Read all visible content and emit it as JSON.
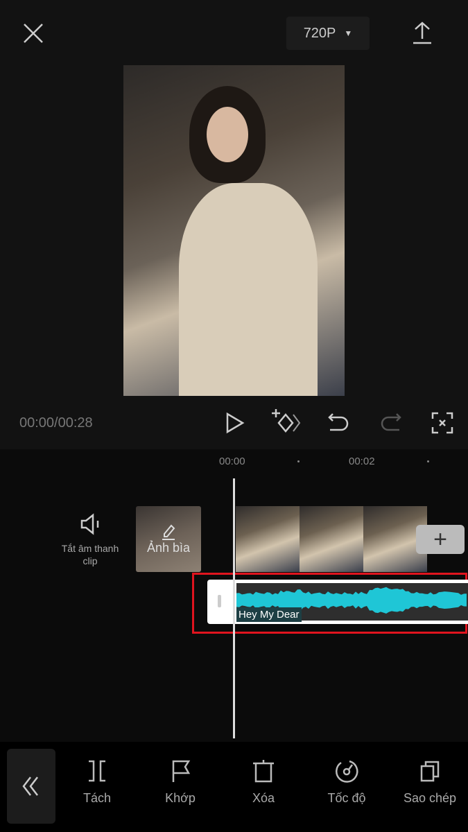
{
  "header": {
    "resolution": "720P",
    "close_icon": "close-icon",
    "export_icon": "upload-icon"
  },
  "player": {
    "time": "00:00/00:28",
    "watermark": "@"
  },
  "timeline": {
    "ticks": [
      "00:00",
      "00:02"
    ],
    "mute_label": "Tắt âm thanh clip",
    "cover_label": "Ảnh bìa",
    "add_label": "+",
    "audio_track": {
      "name": "Hey My Dear",
      "color": "#1fc6d6",
      "selected_border": "#e0141e"
    }
  },
  "toolbar": {
    "items": [
      {
        "label": "Tách",
        "icon": "split-icon"
      },
      {
        "label": "Khớp",
        "icon": "flag-icon"
      },
      {
        "label": "Xóa",
        "icon": "delete-icon"
      },
      {
        "label": "Tốc độ",
        "icon": "speed-icon"
      },
      {
        "label": "Sao chép",
        "icon": "copy-icon"
      }
    ]
  }
}
